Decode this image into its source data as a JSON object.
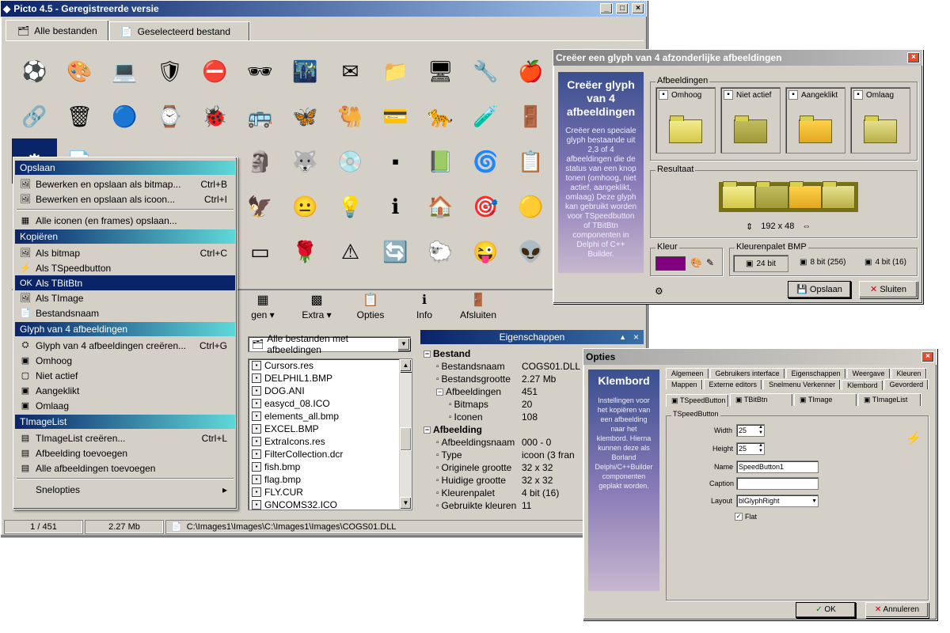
{
  "main": {
    "title": "Picto 4.5 - Geregistreerde versie",
    "tabs": [
      {
        "label": "Alle bestanden",
        "active": true
      },
      {
        "label": "Geselecteerd bestand",
        "active": false
      }
    ],
    "grid_icons": [
      "⚽",
      "🎨",
      "💻",
      "🛡",
      "⛔",
      "🕶",
      "🌃",
      "✉",
      "📁",
      "🖥",
      "🔧",
      "🍎",
      "🔗",
      "🗑",
      "🔵",
      "⌚",
      "🐞",
      "🚌",
      "🦋",
      "🐫",
      "💳",
      "🐆",
      "🧪",
      "🚪",
      "⚙",
      "📄",
      "▫",
      "·",
      "·",
      "🗿",
      "🐺",
      "💿",
      "▪",
      "📗",
      "🌀",
      "📋",
      "",
      "",
      "",
      "",
      "",
      "🦅",
      "😐",
      "💡",
      "ℹ",
      "🏠",
      "🎯",
      "🟡",
      "",
      "",
      "",
      "",
      "",
      "▭",
      "🌹",
      "⚠",
      "🔄",
      "🐑",
      "😜",
      "👽"
    ],
    "toolbar": [
      {
        "icon": "▦",
        "label": "Bewerken",
        "visible_label": "gen"
      },
      {
        "icon": "▩",
        "label": "Extra"
      },
      {
        "icon": "📋",
        "label": "Opties"
      },
      {
        "icon": "ℹ",
        "label": "Info"
      },
      {
        "icon": "🚪",
        "label": "Afsluiten"
      }
    ],
    "filter": {
      "value": "Alle bestanden met afbeeldingen"
    },
    "files": [
      "Cursors.res",
      "DELPHIL1.BMP",
      "DOG.ANI",
      "easycd_08.ICO",
      "elements_all.bmp",
      "EXCEL.BMP",
      "ExtraIcons.res",
      "FilterCollection.dcr",
      "fish.bmp",
      "flag.bmp",
      "FLY.CUR",
      "GNCOMS32.ICO"
    ],
    "properties": {
      "header": "Eigenschappen",
      "rows": [
        {
          "key": "Bestand",
          "value": "",
          "section": true,
          "level": 0
        },
        {
          "key": "Bestandsnaam",
          "value": "COGS01.DLL",
          "level": 1
        },
        {
          "key": "Bestandsgrootte",
          "value": "2.27 Mb",
          "level": 1
        },
        {
          "key": "Afbeeldingen",
          "value": "451",
          "level": 1
        },
        {
          "key": "Bitmaps",
          "value": "20",
          "level": 2
        },
        {
          "key": "Iconen",
          "value": "108",
          "level": 2
        },
        {
          "key": "Afbeelding",
          "value": "",
          "section": true,
          "level": 0
        },
        {
          "key": "Afbeeldingsnaam",
          "value": "000 - 0",
          "level": 1
        },
        {
          "key": "Type",
          "value": "icoon (3 fran",
          "level": 1
        },
        {
          "key": "Originele grootte",
          "value": "32 x 32",
          "level": 1
        },
        {
          "key": "Huidige grootte",
          "value": "32 x 32",
          "level": 1
        },
        {
          "key": "Kleurenpalet",
          "value": "4 bit (16)",
          "level": 1
        },
        {
          "key": "Gebruikte kleuren",
          "value": "11",
          "level": 1
        }
      ]
    },
    "status": {
      "index": "1 / 451",
      "size": "2.27 Mb",
      "path": "C:\\Images1\\Images\\C:\\Images1\\Images\\COGS01.DLL"
    }
  },
  "context_menu": {
    "sections": [
      {
        "header": "Opslaan",
        "items": [
          {
            "icon": "🖼",
            "label": "Bewerken en opslaan als bitmap...",
            "shortcut": "Ctrl+B"
          },
          {
            "icon": "🖼",
            "label": "Bewerken en opslaan als icoon...",
            "shortcut": "Ctrl+I"
          },
          {
            "sep": true
          },
          {
            "icon": "▦",
            "label": "Alle iconen (en frames) opslaan...",
            "shortcut": ""
          }
        ]
      },
      {
        "header": "Kopiëren",
        "items": [
          {
            "icon": "🖼",
            "label": "Als bitmap",
            "shortcut": "Ctrl+C"
          },
          {
            "icon": "⚡",
            "label": "Als TSpeedbutton",
            "shortcut": ""
          },
          {
            "icon": "OK",
            "label": "Als TBitBtn",
            "shortcut": "",
            "highlight": true
          },
          {
            "icon": "🖼",
            "label": "Als TImage",
            "shortcut": ""
          },
          {
            "icon": "📄",
            "label": "Bestandsnaam",
            "shortcut": ""
          }
        ]
      },
      {
        "header": "Glyph van 4 afbeeldingen",
        "items": [
          {
            "icon": "⛭",
            "label": "Glyph van 4 afbeeldingen creëren...",
            "shortcut": "Ctrl+G"
          },
          {
            "icon": "▣",
            "label": "Omhoog",
            "shortcut": ""
          },
          {
            "icon": "▢",
            "label": "Niet actief",
            "shortcut": ""
          },
          {
            "icon": "▣",
            "label": "Aangeklikt",
            "shortcut": ""
          },
          {
            "icon": "▣",
            "label": "Omlaag",
            "shortcut": ""
          }
        ]
      },
      {
        "header": "TImageList",
        "items": [
          {
            "icon": "▤",
            "label": "TImageList creëren...",
            "shortcut": "Ctrl+L"
          },
          {
            "icon": "▤",
            "label": "Afbeelding toevoegen",
            "shortcut": ""
          },
          {
            "icon": "▤",
            "label": "Alle afbeeldingen toevoegen",
            "shortcut": ""
          },
          {
            "sep": true
          },
          {
            "icon": "",
            "label": "Snelopties",
            "shortcut": "▸"
          }
        ]
      }
    ]
  },
  "glyph_dialog": {
    "title": "Creëer een glyph van 4 afzonderlijke afbeeldingen",
    "side_title": "Creëer glyph van 4 afbeeldingen",
    "side_text": "Creëer een speciale glyph bestaande uit 2,3 of 4 afbeeldingen die de status van een knop tonen (omhoog, niet actief, aangeklikt, omlaag) Deze glyph kan gebruikt worden voor TSpeedbutton of TBitBtn componenten in Delphi of C++ Builder.",
    "images_label": "Afbeeldingen",
    "states": [
      "Omhoog",
      "Niet actief",
      "Aangeklikt",
      "Omlaag"
    ],
    "result_label": "Resultaat",
    "result_size": "192 x 48",
    "color_label": "Kleur",
    "color": "#800080",
    "palette_label": "Kleurenpalet BMP",
    "palette_options": [
      "24 bit",
      "8 bit (256)",
      "4 bit (16)"
    ],
    "save_button": "Opslaan",
    "close_button": "Sluiten"
  },
  "options_dialog": {
    "title": "Opties",
    "side_title": "Klembord",
    "side_text": "Instellingen voor het kopiëren van een afbeelding naar het klembord. Hierna kunnen deze als Borland Delphi/C++Builder componenten geplakt worden.",
    "tabs_row1": [
      "Algemeen",
      "Gebruikers interface",
      "Eigenschappen",
      "Weergave",
      "Kleuren"
    ],
    "tabs_row2": [
      "Mappen",
      "Externe editors",
      "Snelmenu Verkenner",
      "Klembord",
      "Gevorderd"
    ],
    "subtabs": [
      "TSpeedButton",
      "TBitBtn",
      "TImage",
      "TImageList"
    ],
    "group_label": "TSpeedButton",
    "width_label": "Width",
    "width_value": "25",
    "height_label": "Height",
    "height_value": "25",
    "name_label": "Name",
    "name_value": "SpeedButton1",
    "caption_label": "Caption",
    "caption_value": "",
    "layout_label": "Layout",
    "layout_value": "blGlyphRight",
    "flat_label": "Flat",
    "ok_button": "OK",
    "cancel_button": "Annuleren"
  }
}
